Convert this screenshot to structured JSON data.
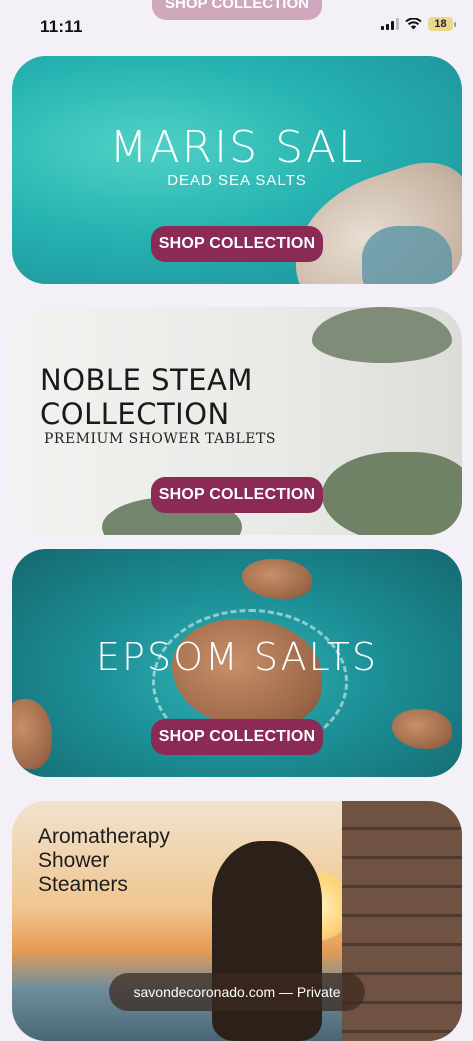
{
  "status_bar": {
    "time": "11:11",
    "battery": "18"
  },
  "top_button_label": "SHOP COLLECTION",
  "cards": [
    {
      "title": "MARIS SAL",
      "subtitle": "DEAD SEA SALTS",
      "button_label": "SHOP COLLECTION"
    },
    {
      "title_line1": "NOBLE STEAM",
      "title_line2": "COLLECTION",
      "subtitle": "PREMIUM SHOWER TABLETS",
      "button_label": "SHOP COLLECTION"
    },
    {
      "title": "EPSOM SALTS",
      "button_label": "SHOP COLLECTION"
    },
    {
      "title_line1": "Aromatherapy",
      "title_line2": "Shower",
      "title_line3": "Steamers"
    }
  ],
  "url_bar": {
    "text": "savondecoronado.com — Private"
  },
  "colors": {
    "button": "#8b2a55",
    "background": "#f3f1f7"
  }
}
